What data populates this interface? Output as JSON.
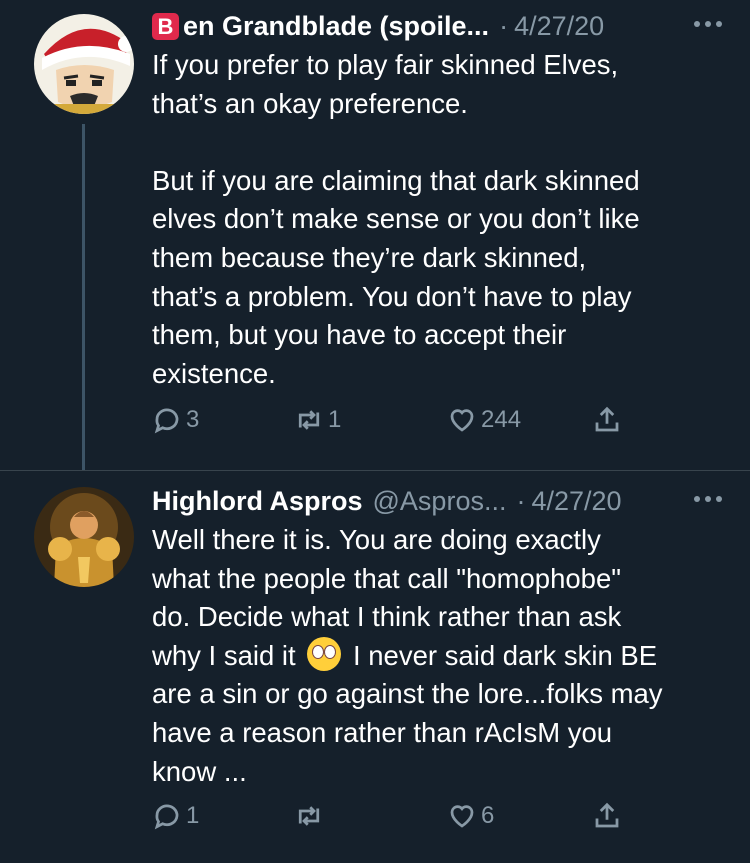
{
  "tweets": [
    {
      "badge": "B",
      "name": "en Grandblade (spoile...",
      "handle": "",
      "separator": "·",
      "date": "4/27/20",
      "body": "If you prefer to play fair skinned Elves,\nthat’s an okay preference.\n\nBut if you are claiming that dark skinned\nelves don’t make sense or you don’t like\nthem because they’re dark skinned,\nthat’s a problem. You don’t have to play\nthem, but you have to accept their\nexistence.",
      "replies": "3",
      "retweets": "1",
      "likes": "244",
      "avatar_icon": "cartoon-avatar-santa-hat"
    },
    {
      "name": "Highlord Aspros",
      "handle": "@Aspros...",
      "separator": "·",
      "date": "4/27/20",
      "body_part1": "Well there it is. You are doing exactly\nwhat the people that call \"homophobe\"\ndo. Decide what I think rather than ask\nwhy I said it",
      "emoji": "face-with-rolling-eyes",
      "body_part2": "I never said dark skin BE\nare a sin or go against the lore...folks may\nhave a reason rather than rAcIsM you\nknow ...",
      "replies": "1",
      "retweets": "",
      "likes": "6",
      "avatar_icon": "armored-paladin-avatar"
    }
  ],
  "colors": {
    "background": "#15202b",
    "text": "#ffffff",
    "muted": "#8899a6",
    "thread_line": "#3d5466"
  }
}
